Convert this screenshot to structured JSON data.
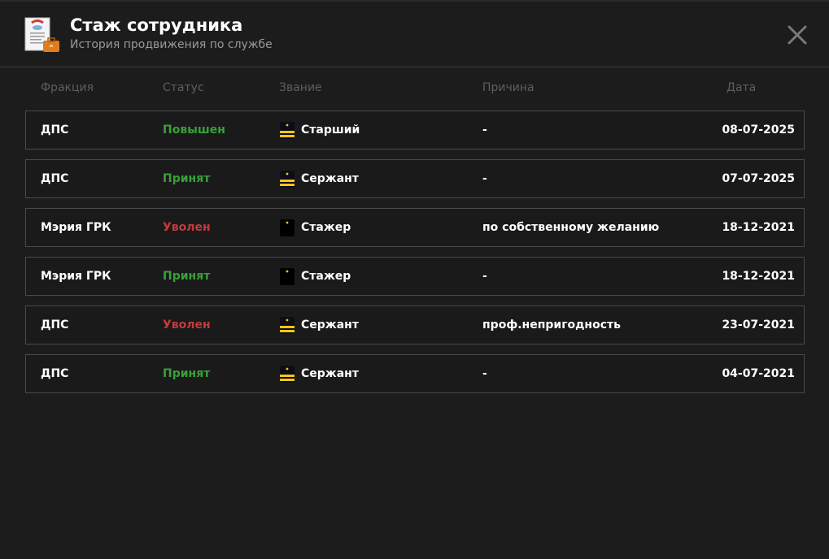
{
  "header": {
    "title": "Стаж сотрудника",
    "subtitle": "История продвижения по службе"
  },
  "columns": {
    "faction": "Фракция",
    "status": "Статус",
    "rank": "Звание",
    "reason": "Причина",
    "date": "Дата"
  },
  "colors": {
    "accepted": "#39a039",
    "fired": "#c23b3b",
    "promoted": "#39a039"
  },
  "rows": [
    {
      "faction": "ДПС",
      "status": "Повышен",
      "status_type": "green",
      "rank": "Старший",
      "rank_icon": "sergeant-shoulder-icon",
      "reason": "-",
      "date": "08-07-2025"
    },
    {
      "faction": "ДПС",
      "status": "Принят",
      "status_type": "green",
      "rank": "Сержант",
      "rank_icon": "sergeant-shoulder-icon",
      "reason": "-",
      "date": "07-07-2025"
    },
    {
      "faction": "Мэрия ГРК",
      "status": "Уволен",
      "status_type": "red",
      "rank": "Стажер",
      "rank_icon": "intern-shoulder-icon",
      "reason": "по собственному желанию",
      "date": "18-12-2021"
    },
    {
      "faction": "Мэрия ГРК",
      "status": "Принят",
      "status_type": "green",
      "rank": "Стажер",
      "rank_icon": "intern-shoulder-icon",
      "reason": "-",
      "date": "18-12-2021"
    },
    {
      "faction": "ДПС",
      "status": "Уволен",
      "status_type": "red",
      "rank": "Сержант",
      "rank_icon": "sergeant-shoulder-icon",
      "reason": "проф.непригодность",
      "date": "23-07-2021"
    },
    {
      "faction": "ДПС",
      "status": "Принят",
      "status_type": "green",
      "rank": "Сержант",
      "rank_icon": "sergeant-shoulder-icon",
      "reason": "-",
      "date": "04-07-2021"
    }
  ]
}
